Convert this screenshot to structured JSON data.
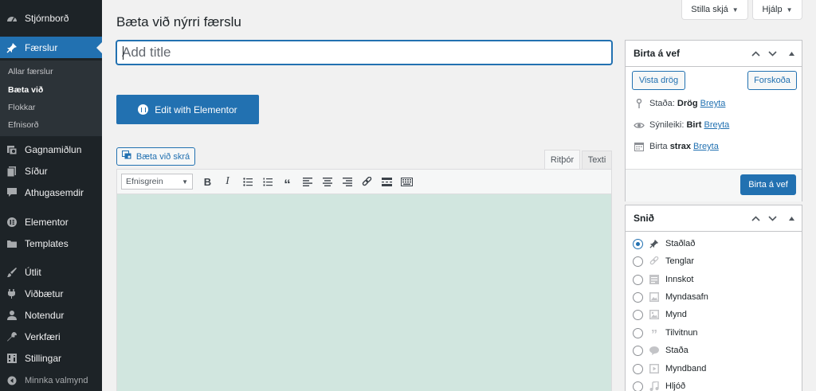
{
  "sidebar": {
    "items": [
      {
        "label": "Stjórnborð",
        "icon": "dashboard-icon"
      },
      {
        "label": "Færslur",
        "icon": "pin-icon"
      },
      {
        "label": "Gagnamiðlun",
        "icon": "media-icon"
      },
      {
        "label": "Síður",
        "icon": "pages-icon"
      },
      {
        "label": "Athugasemdir",
        "icon": "comments-icon"
      },
      {
        "label": "Elementor",
        "icon": "elementor-icon"
      },
      {
        "label": "Templates",
        "icon": "folder-icon"
      },
      {
        "label": "Útlit",
        "icon": "brush-icon"
      },
      {
        "label": "Viðbætur",
        "icon": "plugin-icon"
      },
      {
        "label": "Notendur",
        "icon": "users-icon"
      },
      {
        "label": "Verkfæri",
        "icon": "wrench-icon"
      },
      {
        "label": "Stillingar",
        "icon": "settings-icon"
      }
    ],
    "submenu": [
      "Allar færslur",
      "Bæta við",
      "Flokkar",
      "Efnisorð"
    ],
    "collapse_label": "Minnka valmynd"
  },
  "screen_options_label": "Stilla skjá",
  "help_label": "Hjálp",
  "page_title": "Bæta við nýrri færslu",
  "title_placeholder": "Add title",
  "elementor_button_label": "Edit with Elementor",
  "add_media_label": "Bæta við skrá",
  "editor_tabs": {
    "visual": "Ritþór",
    "text": "Texti"
  },
  "toolbar": {
    "format_select": "Efnisgrein"
  },
  "publish_box": {
    "title": "Birta á vef",
    "save_draft": "Vista drög",
    "preview": "Forskoða",
    "status_label": "Staða:",
    "status_value": "Drög",
    "visibility_label": "Sýnileiki:",
    "visibility_value": "Birt",
    "schedule_label": "Birta",
    "schedule_value": "strax",
    "edit_link": "Breyta",
    "publish_button": "Birta á vef"
  },
  "format_box": {
    "title": "Snið",
    "options": [
      "Staðlað",
      "Tenglar",
      "Innskot",
      "Myndasafn",
      "Mynd",
      "Tilvitnun",
      "Staða",
      "Myndband",
      "Hljóð"
    ],
    "selected": "Staðlað"
  },
  "colors": {
    "accent": "#2271b1",
    "sidebar": "#1d2327",
    "editor_bg": "#d1e6df"
  }
}
